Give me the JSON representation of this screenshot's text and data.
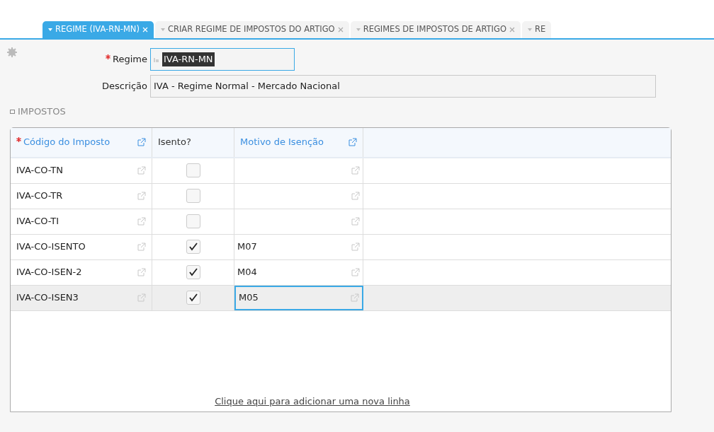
{
  "tabs": [
    {
      "label": "REGIME (IVA-RN-MN)",
      "selected": true,
      "closable": true
    },
    {
      "label": "CRIAR REGIME DE IMPOSTOS DO ARTIGO",
      "selected": false,
      "closable": true
    },
    {
      "label": "REGIMES DE IMPOSTOS DE ARTIGO",
      "selected": false,
      "closable": true
    },
    {
      "label": "RE",
      "selected": false,
      "closable": false
    }
  ],
  "form": {
    "fields": [
      {
        "label": "Regime",
        "required": true,
        "value": "IVA-RN-MN",
        "highlighted": true,
        "focused": true,
        "prefix_icon": true
      },
      {
        "label": "Descrição",
        "required": false,
        "value": "IVA - Regime Normal - Mercado Nacional",
        "highlighted": false,
        "focused": false,
        "prefix_icon": false
      }
    ]
  },
  "section": {
    "title": "IMPOSTOS",
    "expanded": true
  },
  "table": {
    "columns": [
      {
        "label": "Código do Imposto",
        "kind": "lookup",
        "required": true
      },
      {
        "label": "Isento?",
        "kind": "check",
        "required": false
      },
      {
        "label": "Motivo de Isenção",
        "kind": "lookup",
        "required": false
      }
    ],
    "rows": [
      {
        "code": "IVA-CO-TN",
        "exempt": false,
        "reason": "",
        "selected": false,
        "reason_focused": false
      },
      {
        "code": "IVA-CO-TR",
        "exempt": false,
        "reason": "",
        "selected": false,
        "reason_focused": false
      },
      {
        "code": "IVA-CO-TI",
        "exempt": false,
        "reason": "",
        "selected": false,
        "reason_focused": false
      },
      {
        "code": "IVA-CO-ISENTO",
        "exempt": true,
        "reason": "M07",
        "selected": false,
        "reason_focused": false
      },
      {
        "code": "IVA-CO-ISEN-2",
        "exempt": true,
        "reason": "M04",
        "selected": false,
        "reason_focused": false
      },
      {
        "code": "IVA-CO-ISEN3",
        "exempt": true,
        "reason": "M05",
        "selected": true,
        "reason_focused": true
      }
    ],
    "add_row_link": "Clique aqui para adicionar uma nova linha"
  }
}
